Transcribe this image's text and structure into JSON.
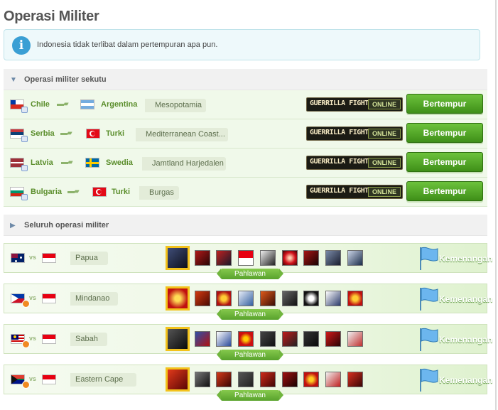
{
  "page": {
    "title": "Operasi Militer",
    "info_text": "Indonesia tidak terlibat dalam pertempuran apa pun."
  },
  "allied_section": {
    "header": "Operasi militer sekutu",
    "rows": [
      {
        "attacker": "Chile",
        "defender": "Argentina",
        "region": "Mesopotamia",
        "guerrilla_label": "GUERRILLA FIGHT",
        "guerrilla_status": "ONLINE",
        "button": "Bertempur"
      },
      {
        "attacker": "Serbia",
        "defender": "Turki",
        "region": "Mediterranean Coast...",
        "guerrilla_label": "GUERRILLA FIGHT",
        "guerrilla_status": "ONLINE",
        "button": "Bertempur"
      },
      {
        "attacker": "Latvia",
        "defender": "Swedia",
        "region": "Jamtland Harjedalen",
        "guerrilla_label": "GUERRILLA FIGHT",
        "guerrilla_status": "ONLINE",
        "button": "Bertempur"
      },
      {
        "attacker": "Bulgaria",
        "defender": "Turki",
        "region": "Burgas",
        "guerrilla_label": "GUERRILLA FIGHT",
        "guerrilla_status": "ONLINE",
        "button": "Bertempur"
      }
    ]
  },
  "all_section": {
    "header": "Seluruh operasi militer",
    "rows": [
      {
        "vs": "vs",
        "region": "Papua",
        "hero_label": "Pahlawan",
        "status": "Kemenangan"
      },
      {
        "vs": "vs",
        "region": "Mindanao",
        "hero_label": "Pahlawan",
        "status": "Kemenangan"
      },
      {
        "vs": "vs",
        "region": "Sabah",
        "hero_label": "Pahlawan",
        "status": "Kemenangan"
      },
      {
        "vs": "vs",
        "region": "Eastern Cape",
        "hero_label": "Pahlawan",
        "status": "Kemenangan"
      }
    ]
  },
  "colors": {
    "accent_green": "#5b8e2c",
    "button_green": "#4fa626",
    "hero_border": "#f3c21b",
    "info_blue": "#3a9fd4"
  }
}
